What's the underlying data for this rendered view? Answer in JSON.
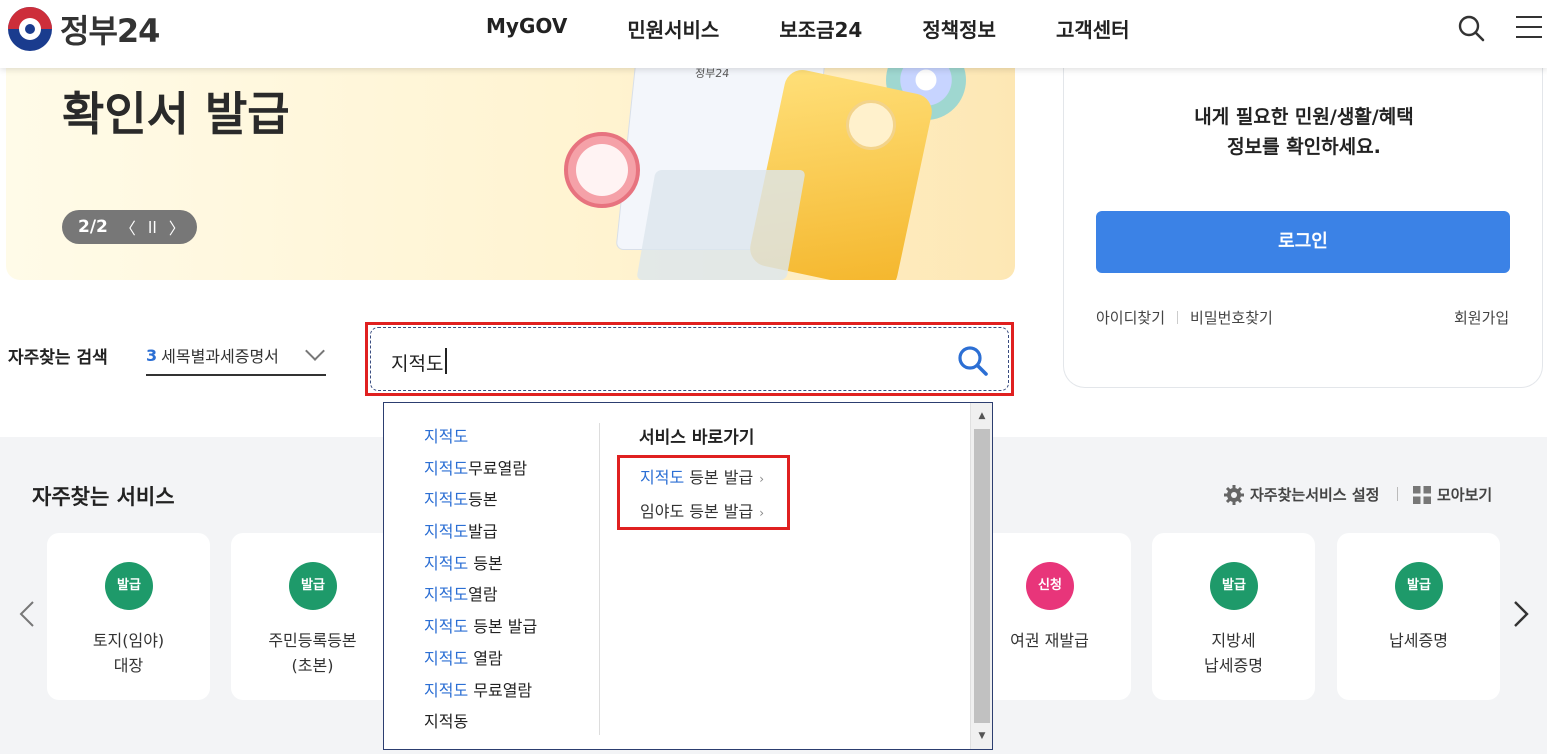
{
  "header": {
    "logo_text": "정부24",
    "nav": [
      "MyGOV",
      "민원서비스",
      "보조금24",
      "정책정보",
      "고객센터"
    ]
  },
  "banner": {
    "title": "확인서 발급",
    "pager": "2/2",
    "prev": "〈",
    "pause": "ll",
    "next": "〉",
    "doc_label": "정부24"
  },
  "login": {
    "message_line1": "내게 필요한 민원/생활/혜택",
    "message_line2": "정보를 확인하세요.",
    "button": "로그인",
    "find_id": "아이디찾기",
    "find_pw": "비밀번호찾기",
    "signup": "회원가입"
  },
  "search": {
    "freq_label": "자주찾는 검색",
    "freq_rank": "3",
    "freq_keyword": "세목별과세증명서",
    "query": "지적도"
  },
  "autocomplete": {
    "suggestions": [
      {
        "hl": "지적도",
        "rest": ""
      },
      {
        "hl": "지적도",
        "rest": "무료열람"
      },
      {
        "hl": "지적도",
        "rest": "등본"
      },
      {
        "hl": "지적도",
        "rest": "발급"
      },
      {
        "hl": "지적도",
        "rest": " 등본"
      },
      {
        "hl": "지적도",
        "rest": "열람"
      },
      {
        "hl": "지적도",
        "rest": " 등본 발급"
      },
      {
        "hl": "지적도",
        "rest": " 열람"
      },
      {
        "hl": "지적도",
        "rest": " 무료열람"
      },
      {
        "hl": "",
        "rest": "지적동"
      }
    ],
    "quick_title": "서비스 바로가기",
    "quick_links": [
      {
        "hl": "지적도",
        "rest": " 등본 발급"
      },
      {
        "hl": "",
        "rest": "임야도 등본 발급"
      }
    ],
    "quick_arrow": "›"
  },
  "services": {
    "title": "자주찾는 서비스",
    "setting": "자주찾는서비스 설정",
    "view_all": "모아보기",
    "cards": [
      {
        "badge": "발급",
        "badge_color": "#1e9a6a",
        "label": "토지(임야)\n대장"
      },
      {
        "badge": "발급",
        "badge_color": "#1e9a6a",
        "label": "주민등록등본\n(초본)"
      },
      {
        "badge": "신청",
        "badge_color": "#e8357a",
        "label": "여권 재발급"
      },
      {
        "badge": "발급",
        "badge_color": "#1e9a6a",
        "label": "지방세\n납세증명"
      },
      {
        "badge": "발급",
        "badge_color": "#1e9a6a",
        "label": "납세증명"
      }
    ]
  },
  "colors": {
    "accent": "#3b82e6",
    "highlight": "#2c6fd4",
    "annotation_red": "#e02020"
  }
}
